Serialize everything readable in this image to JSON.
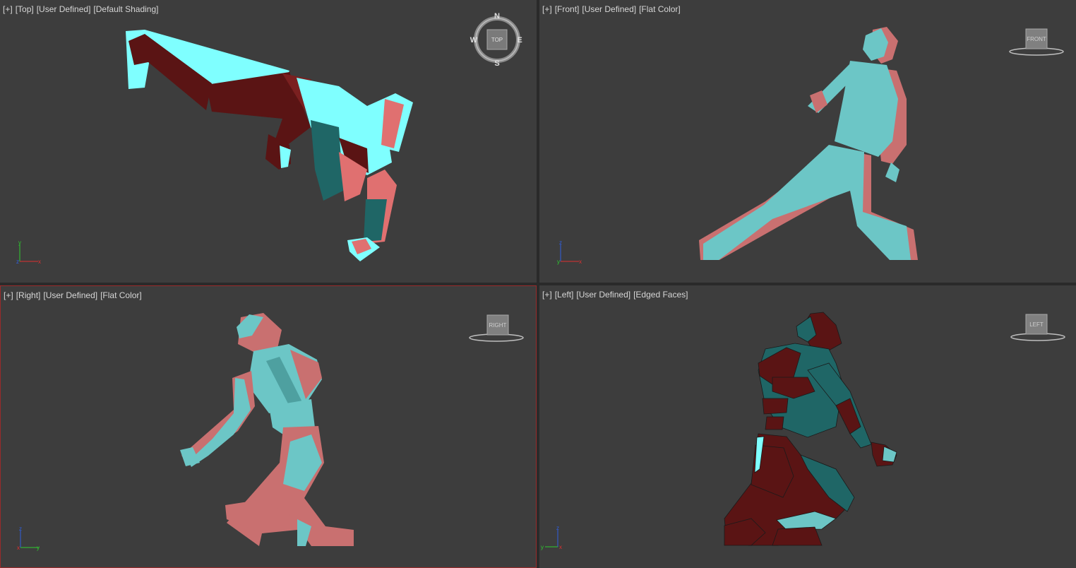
{
  "viewports": [
    {
      "id": "top",
      "labels": [
        "[+]",
        "[Top]",
        "[User Defined]",
        "[Default Shading]"
      ],
      "cube_label": "TOP",
      "axes": [
        "y",
        "x",
        "z"
      ]
    },
    {
      "id": "front",
      "labels": [
        "[+]",
        "[Front]",
        "[User Defined]",
        "[Flat Color]"
      ],
      "cube_label": "FRONT",
      "axes": [
        "z",
        "x",
        "y"
      ]
    },
    {
      "id": "right",
      "labels": [
        "[+]",
        "[Right]",
        "[User Defined]",
        "[Flat Color]"
      ],
      "cube_label": "RIGHT",
      "axes": [
        "z",
        "y",
        "x"
      ]
    },
    {
      "id": "left",
      "labels": [
        "[+]",
        "[Left]",
        "[User Defined]",
        "[Edged Faces]"
      ],
      "cube_label": "LEFT",
      "axes": [
        "z",
        "y",
        "x"
      ]
    }
  ],
  "compass": {
    "n": "N",
    "s": "S",
    "e": "E",
    "w": "W"
  },
  "colors": {
    "cyan": "#7fffff",
    "teal": "#6cc6c6",
    "salmon": "#c97070",
    "maroon": "#5a1414",
    "bg": "#3d3d3d",
    "active_border": "#9a2b2b"
  }
}
